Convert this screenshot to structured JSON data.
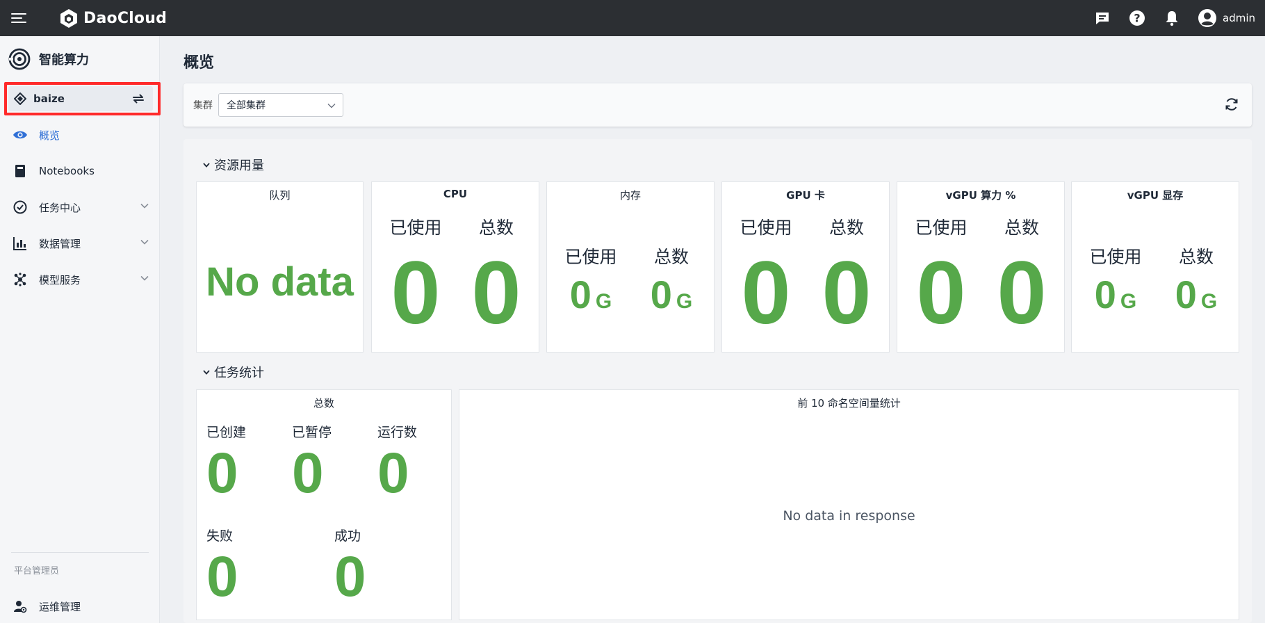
{
  "topbar": {
    "brand": "DaoCloud",
    "user": "admin",
    "icons": [
      "menu-icon",
      "message-icon",
      "help-icon",
      "bell-icon",
      "user-avatar-icon"
    ]
  },
  "sidebar": {
    "product": "智能算力",
    "workspace": "baize",
    "items": [
      {
        "label": "概览",
        "icon": "eye-icon",
        "active": true
      },
      {
        "label": "Notebooks",
        "icon": "notebook-icon"
      },
      {
        "label": "任务中心",
        "icon": "task-icon",
        "expandable": true
      },
      {
        "label": "数据管理",
        "icon": "data-icon",
        "expandable": true
      },
      {
        "label": "模型服务",
        "icon": "model-icon",
        "expandable": true
      }
    ],
    "section": "平台管理员",
    "ops": {
      "label": "运维管理",
      "icon": "ops-icon"
    }
  },
  "page": {
    "title": "概览",
    "filter": {
      "label": "集群",
      "value": "全部集群"
    }
  },
  "resources": {
    "title": "资源用量",
    "queue": {
      "title": "队列",
      "value": "No data"
    },
    "cpu": {
      "title": "CPU",
      "used_label": "已使用",
      "total_label": "总数",
      "used": "0",
      "total": "0"
    },
    "memory": {
      "title": "内存",
      "used_label": "已使用",
      "total_label": "总数",
      "used": "0",
      "total": "0",
      "unit": "G"
    },
    "gpu": {
      "title": "GPU 卡",
      "used_label": "已使用",
      "total_label": "总数",
      "used": "0",
      "total": "0"
    },
    "vgpu_compute": {
      "title": "vGPU 算力 %",
      "used_label": "已使用",
      "total_label": "总数",
      "used": "0",
      "total": "0"
    },
    "vgpu_memory": {
      "title": "vGPU 显存",
      "used_label": "已使用",
      "total_label": "总数",
      "used": "0",
      "total": "0",
      "unit": "G"
    }
  },
  "tasks": {
    "title": "任务统计",
    "totals": {
      "title": "总数",
      "created_label": "已创建",
      "created": "0",
      "paused_label": "已暂停",
      "paused": "0",
      "running_label": "运行数",
      "running": "0",
      "failed_label": "失败",
      "failed": "0",
      "succeeded_label": "成功",
      "succeeded": "0"
    },
    "top_ns": {
      "title": "前 10 命名空间量统计",
      "empty": "No data in response"
    }
  },
  "colors": {
    "accent": "#2f6fd6",
    "value_green": "#56a84a",
    "topbar": "#2c2f33",
    "highlight": "#ff2a2a"
  }
}
